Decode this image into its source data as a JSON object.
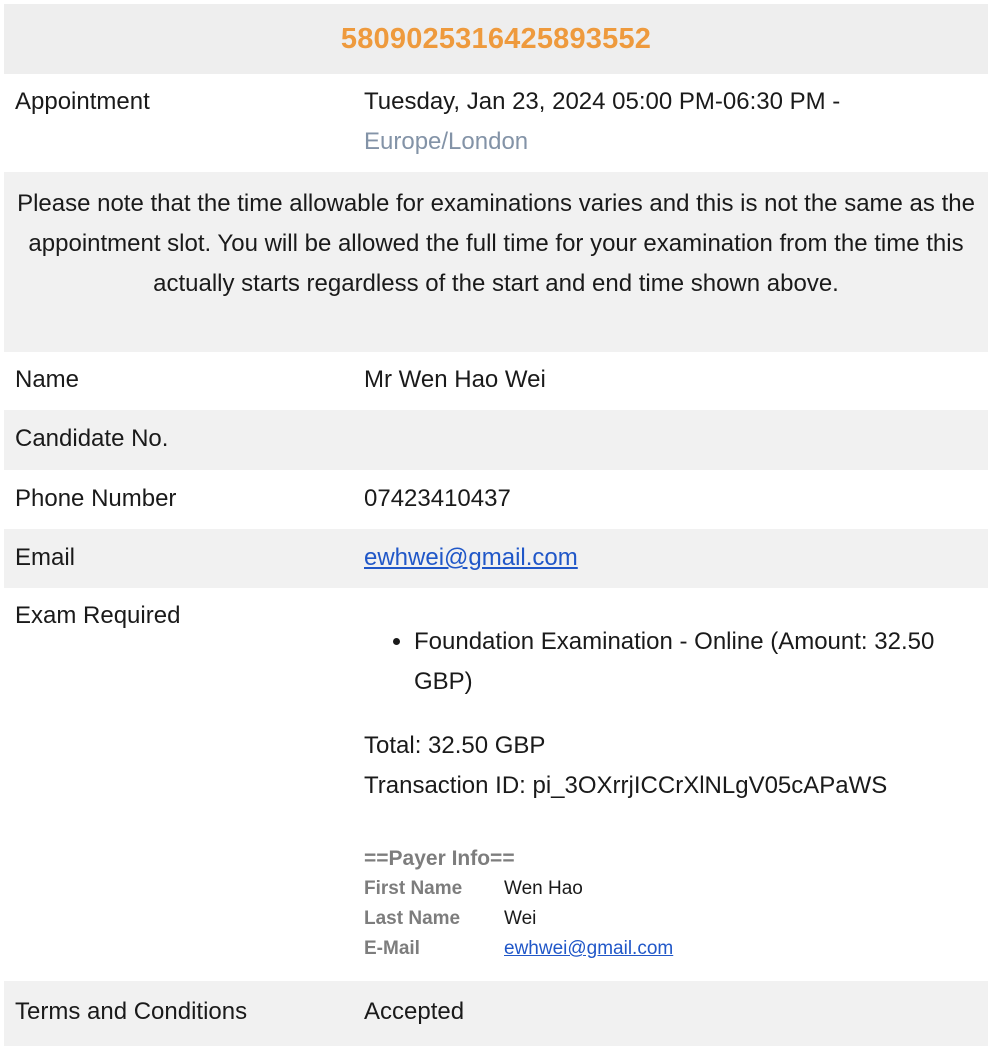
{
  "header": {
    "booking_number": "5809025316425893552"
  },
  "appointment": {
    "label": "Appointment",
    "datetime": "Tuesday, Jan 23, 2024 05:00 PM-06:30 PM -",
    "timezone": "Europe/London"
  },
  "note": "Please note that the time allowable for examinations varies and this is not the same as the appointment slot.  You will be allowed the full time for your examination from the time this actually starts regardless of the start and end time shown above.",
  "name": {
    "label": "Name",
    "value": "Mr Wen Hao Wei"
  },
  "candidate": {
    "label": "Candidate No.",
    "value": ""
  },
  "phone": {
    "label": "Phone Number",
    "value": "07423410437"
  },
  "email": {
    "label": "Email",
    "value": "ewhwei@gmail.com"
  },
  "exam": {
    "label": "Exam Required",
    "items": [
      "Foundation Examination - Online (Amount: 32.50 GBP)"
    ],
    "total": "Total: 32.50 GBP",
    "transaction": "Transaction ID: pi_3OXrrjICCrXlNLgV05cAPaWS"
  },
  "payer": {
    "title": "==Payer Info==",
    "first_name_label": "First Name",
    "first_name": "Wen Hao",
    "last_name_label": "Last Name",
    "last_name": "Wei",
    "email_label": "E-Mail",
    "email": "ewhwei@gmail.com"
  },
  "terms": {
    "label": "Terms and Conditions",
    "value": "Accepted"
  },
  "colors": {
    "accent": "#ee9a3d",
    "link": "#2057c8",
    "timezone": "#8393a7",
    "row_alt": "#f1f1f1"
  }
}
